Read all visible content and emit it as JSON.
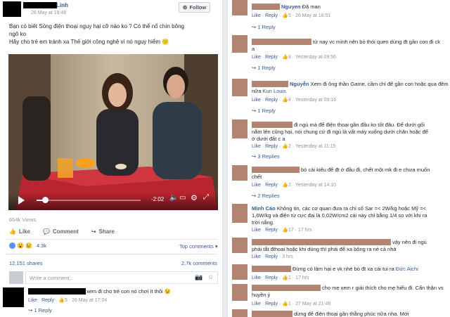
{
  "post": {
    "author_suffix": "Linh",
    "timestamp": "26 May at 16:48",
    "follow_label": "Follow",
    "text_line1": "Bạn có biết Sóng điện thoại nguy hại cỡ nào ko ? Có thể nổ chín bông",
    "text_line2": "ngô ko",
    "text_line3": "Hãy cho trẻ em tránh xa Thế giới công nghệ vì nó nguy hiểm 🙂",
    "video_time": "-2:02",
    "views": "654k Views",
    "progress_fraction": 0.08,
    "like_label": "Like",
    "comment_label": "Comment",
    "share_label": "Share",
    "reactions_count": "4.3k",
    "top_comments_label": "Top comments",
    "shares_text": "12,151 shares",
    "comments_count": "2.7k comments",
    "comment_placeholder": "Write a comment...",
    "first_comment": {
      "text": "xem đi cho trẻ con nó chơi ít thôi 😉",
      "like": "Like",
      "reply": "Reply",
      "likes": "5",
      "time": "26 May at 17:04",
      "replies": "1 Reply"
    }
  },
  "comments": [
    {
      "name": "Nguyen",
      "text": "Đã man",
      "like": "Like",
      "reply": "Reply",
      "likes": "5",
      "time": "26 May at 16:51",
      "replies": "1 Reply"
    },
    {
      "text_line1": "từ nay vc mình nên bỏ thói quen dùng đt gần con đi ck",
      "text_line2": "a",
      "like": "Like",
      "reply": "Reply",
      "likes": "8",
      "time": "Yesterday at 09:56",
      "replies": "1 Reply"
    },
    {
      "name": "Nguyễn",
      "text_line1": "Xem đi ông thần Game, cầm chỉ để gần con hoặc qua đêm",
      "text_line2": "nữa",
      "mention": "Kun Louis",
      "like": "Like",
      "reply": "Reply",
      "likes": "4",
      "time": "Yesterday at 09:16",
      "replies": "1 Reply"
    },
    {
      "text_line1": "đi ngủ mà để điện thoại gần đầu ko tốt đâu. Để dưới gối",
      "text_line2": "nằm lên cũng hại, nói chung cứ đi ngủ là vất máy xuống dưới chăn hoặc để",
      "text_line3": "ở dưới đất c a",
      "like": "Like",
      "reply": "Reply",
      "likes": "2",
      "time": "Yesterday at 11:15",
      "replies": "3 Replies"
    },
    {
      "text_line1": "bó cái kiểu để đt ở đầu đi, chết một mk đi e chưa muốn",
      "text_line2": "chết",
      "like": "Like",
      "reply": "Reply",
      "likes": "2",
      "time": "Yesterday at 14:10",
      "replies": "2 Replies"
    },
    {
      "name": "Minh Cáo",
      "text_line1": "Không tin, các cơ quan đưa ra chỉ số Sar =< 2W/kg hoặc Mỹ =<",
      "text_line2": "1,6W/kg và điện từ cực đại là 0,02W/cm2 cái này chỉ bằng 1/4 so với khi ra",
      "text_line3": "trời nắng.",
      "like": "Like",
      "reply": "Reply",
      "likes": "17",
      "time": "17 hrs"
    },
    {
      "text_line1": "vậy nên đi ngủ",
      "text_line2": "phải tắt đthoai hoặc khi dùng thì phải để xa bông ra nè cả nhà",
      "like": "Like",
      "reply": "Reply",
      "time": "3 hrs"
    },
    {
      "text": "Đừng có làm hại e vk nhé bỏ đt xa cái tui ra",
      "mention": "Đức Aichi",
      "like": "Like",
      "reply": "Reply",
      "likes": "1",
      "time": "17 hrs"
    },
    {
      "text_line1": "cho mẹ xem r giải thích cho mẹ hiểu đi. Cẩn thận vs",
      "text_line2": "huyền ý",
      "like": "Like",
      "reply": "Reply",
      "likes": "1",
      "time": "27 May at 21:48"
    },
    {
      "text": "dừng để điện thoại gần thằng phúc nữa nha. Mới"
    }
  ],
  "colors": {
    "link": "#365899",
    "muted": "#90949c",
    "redaction": "#b48472",
    "table_red": "#b8242f"
  }
}
